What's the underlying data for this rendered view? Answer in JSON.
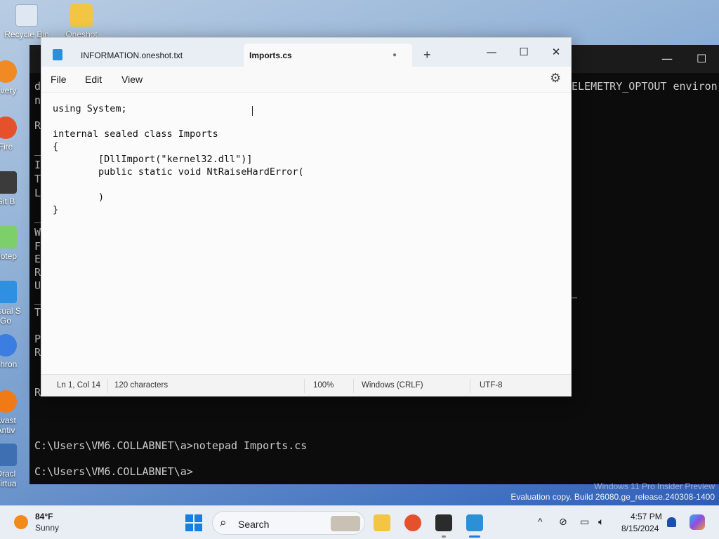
{
  "desktop": {
    "icons": [
      {
        "label": "Recycle Bin"
      },
      {
        "label": "Oneshot"
      },
      {
        "label": "Every"
      },
      {
        "label": "Fire"
      },
      {
        "label": "Git B"
      },
      {
        "label": "Notep"
      },
      {
        "label": "Visual S"
      },
      {
        "label": "Go"
      },
      {
        "label": "Chron"
      },
      {
        "label": "Avast"
      },
      {
        "label": "Antiv"
      },
      {
        "label": "Oracl"
      },
      {
        "label": "Virtua"
      }
    ],
    "watermark": {
      "line1": "Windows 11 Pro Insider Preview",
      "line2": "Evaluation copy. Build 26080.ge_release.240308-1400"
    }
  },
  "terminal": {
    "header_fragment": "ELEMETRY_OPTOUT environ",
    "left_fragments": [
      "d",
      "n",
      "R",
      "_",
      "I",
      "T",
      "L",
      "_",
      "W",
      "F",
      "E",
      "R",
      "U",
      "_",
      "T",
      "P",
      "R",
      "R"
    ],
    "prompt_line1": "C:\\Users\\VM6.COLLABNET\\a>notepad Imports.cs",
    "prompt_line2": "C:\\Users\\VM6.COLLABNET\\a>"
  },
  "notepad": {
    "tabs": [
      {
        "label": "INFORMATION.oneshot.txt",
        "active": false
      },
      {
        "label": "Imports.cs",
        "active": true,
        "unsaved_dot": "●"
      }
    ],
    "new_tab_label": "+",
    "window_controls": {
      "minimize": "—",
      "maximize": "☐",
      "close": "✕"
    },
    "menu": {
      "file": "File",
      "edit": "Edit",
      "view": "View"
    },
    "settings_icon": "⚙",
    "code_lines": [
      "using System;",
      "",
      "internal sealed class Imports",
      "{",
      "        [DllImport(\"kernel32.dll\")]",
      "        public static void NtRaiseHardError(",
      "",
      "        )",
      "}"
    ],
    "status": {
      "position": "Ln 1, Col 14",
      "chars": "120 characters",
      "zoom": "100%",
      "line_ending": "Windows (CRLF)",
      "encoding": "UTF-8"
    }
  },
  "taskbar": {
    "weather": {
      "temp": "84°F",
      "condition": "Sunny"
    },
    "search_label": "Search",
    "clock": {
      "time": "4:57 PM",
      "date": "8/15/2024"
    },
    "tray_chevron": "^"
  }
}
